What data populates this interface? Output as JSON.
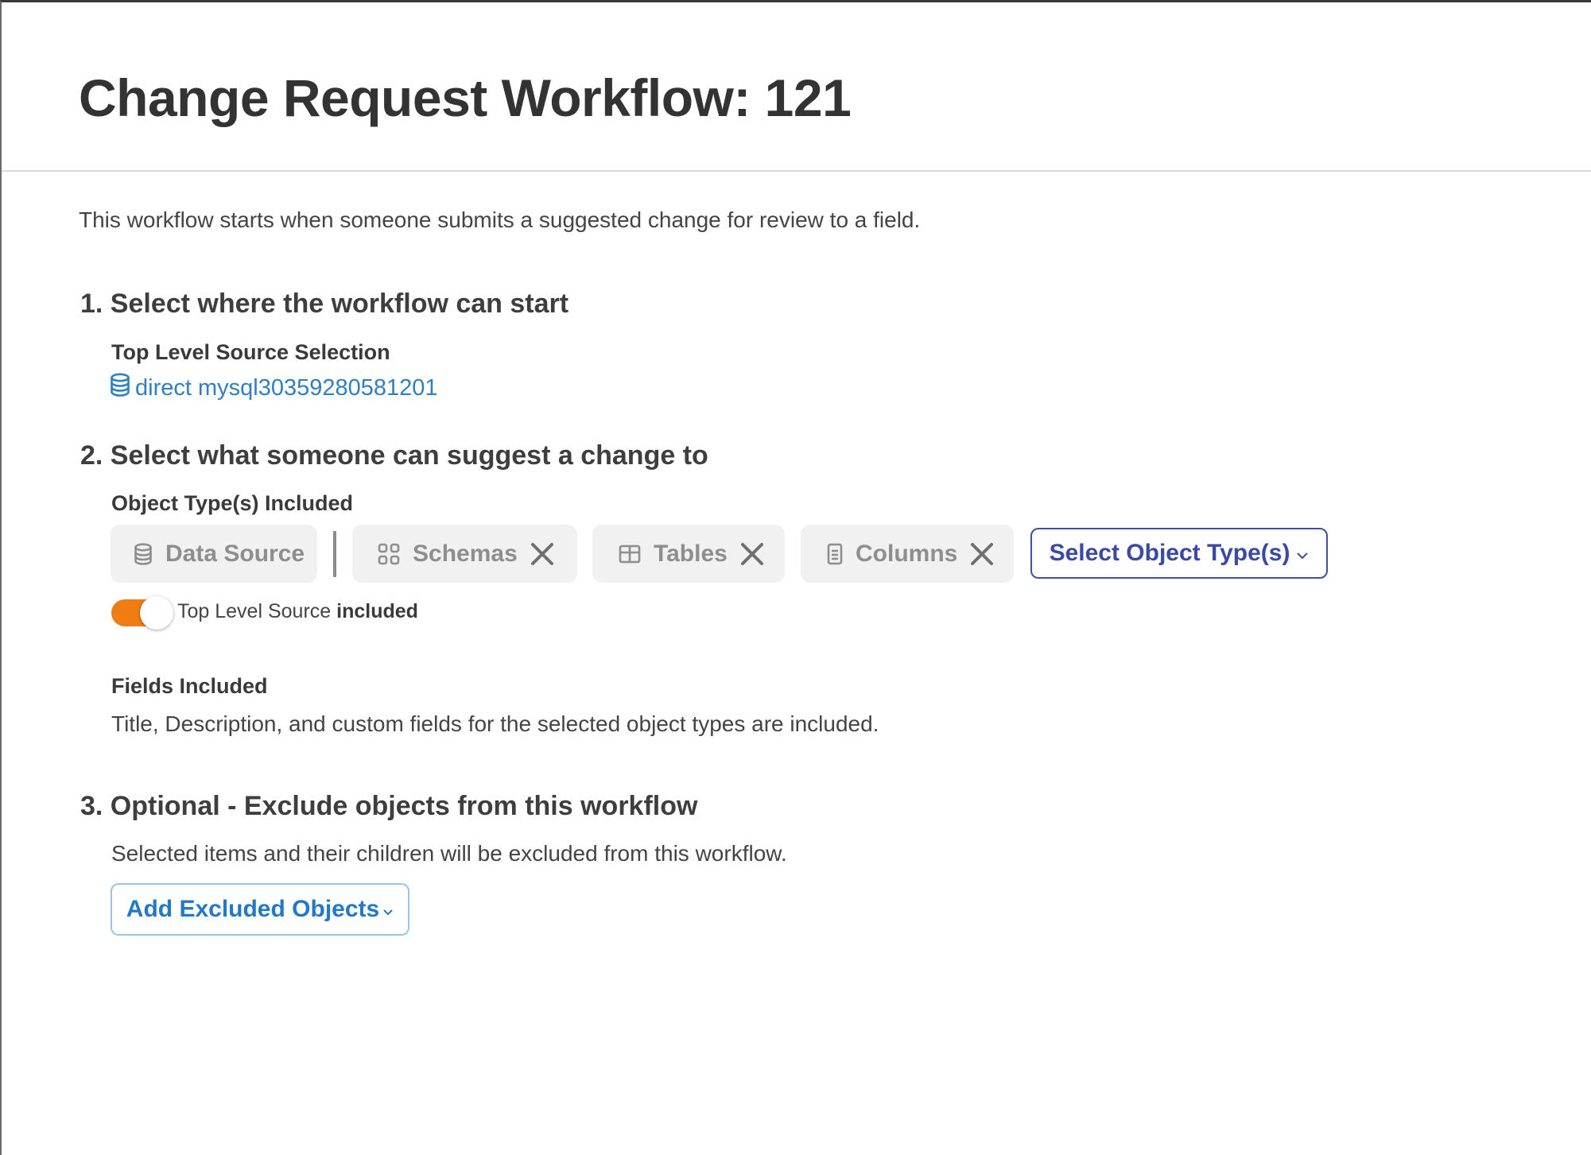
{
  "header": {
    "title": "Change Request Workflow: 121"
  },
  "intro": "This workflow starts when someone submits a suggested change for review to a field.",
  "step1": {
    "heading": "1. Select where the workflow can start",
    "label": "Top Level Source Selection",
    "source": {
      "name": "direct mysql30359280581201",
      "icon": "database-icon"
    }
  },
  "step2": {
    "heading": "2. Select what someone can suggest a change to",
    "label": "Object Type(s) Included",
    "object_types": [
      {
        "label": "Data Source",
        "icon": "database-icon",
        "removable": false
      },
      {
        "label": "Schemas",
        "icon": "grid-icon",
        "removable": true
      },
      {
        "label": "Tables",
        "icon": "table-icon",
        "removable": true
      },
      {
        "label": "Columns",
        "icon": "column-icon",
        "removable": true
      }
    ],
    "select_button": "Select Object Type(s)",
    "toggle": {
      "on": true,
      "label": "Top Level Source",
      "status": "included"
    },
    "fields_label": "Fields Included",
    "fields_text": "Title, Description, and custom fields for the selected object types are included."
  },
  "step3": {
    "heading": "3. Optional - Exclude objects from this workflow",
    "text": "Selected items and their children will be excluded from this workflow.",
    "button": "Add Excluded Objects"
  },
  "colors": {
    "toggle_on": "#f07d14",
    "link": "#2f7fc2",
    "select_button": "#3a48a6",
    "exclude_button": "#2278c9"
  }
}
